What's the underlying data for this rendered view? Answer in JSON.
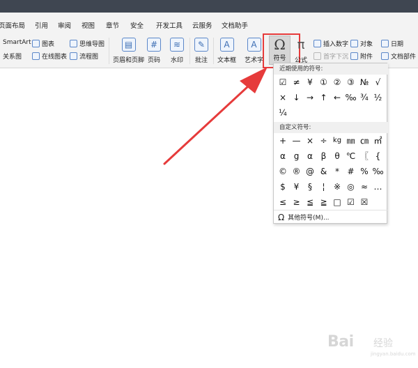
{
  "menu": [
    "页面布局",
    "引用",
    "审阅",
    "视图",
    "章节",
    "安全",
    "开发工具",
    "云服务",
    "文档助手"
  ],
  "ribbon": {
    "smartart": "SmartArt",
    "chart": "图表",
    "mindmap": "思维导图",
    "relation": "关系图",
    "online_chart": "在线图表",
    "flowchart": "流程图",
    "header_footer": "页眉和页脚",
    "page_number": "页码",
    "watermark": "水印",
    "comment": "批注",
    "textbox": "文本框",
    "wordart": "艺术字",
    "symbol": "符号",
    "formula": "公式",
    "insert_number": "插入数字",
    "object": "对象",
    "date": "日期",
    "drop_cap": "首字下沉",
    "attachment": "附件",
    "doc_parts": "文档部件"
  },
  "popup": {
    "recent_title": "近期使用的符号:",
    "recent_symbols": [
      "☑",
      "≠",
      "¥",
      "①",
      "②",
      "③",
      "№",
      "√",
      "×",
      "↓",
      "→",
      "↑",
      "←",
      "‰",
      "¾",
      "½",
      "¼"
    ],
    "custom_title": "自定义符号:",
    "custom_symbols": [
      "+",
      "—",
      "×",
      "÷",
      "kg",
      "㎜",
      "㎝",
      "㎡",
      "α",
      "g",
      "α",
      "β",
      "θ",
      "℃",
      "〖",
      "{",
      "©",
      "®",
      "@",
      "&",
      "*",
      "#",
      "%",
      "‰",
      "$",
      "¥",
      "§",
      "¦",
      "※",
      "◎",
      "≈",
      "…",
      "≤",
      "≥",
      "≦",
      "≧",
      "□",
      "☑",
      "☒"
    ],
    "more": "其他符号(M)..."
  },
  "watermark": {
    "brand": "Bai",
    "sub": "经验",
    "url": "jingyan.baidu.com"
  },
  "colors": {
    "annotation_red": "#e63b3b",
    "titlebar": "#3f4651"
  }
}
